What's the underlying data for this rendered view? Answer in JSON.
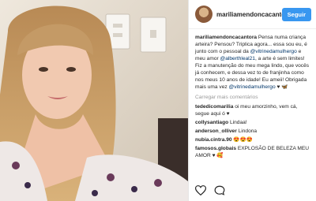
{
  "post": {
    "username": "mariliamendoncacantora",
    "follow_label": "Seguir",
    "caption": {
      "username": "mariliamendoncacantora",
      "text1": " Pensa numa criança arteira? Pensou? Triplica agora... essa sou eu, é junto com o pessoal da ",
      "mention1": "@vitrinedamulhergo",
      "text2": " e meu amor ",
      "mention2": "@alberthleal21",
      "text3": ", a arte é sem limites! Fiz a manutenção do meu mega lindo, que vocês já conhecem, e dessa vez to de franjinha como nos meus 10 anos de idade! Eu ameii! Obrigada mais uma vez ",
      "mention3": "@vitrinedamulhergo",
      "text4": " ♥ 🦋"
    },
    "load_more": "Carregar mais comentários",
    "comments": [
      {
        "user": "tededicomarilia",
        "text": " oi meu amorzinho, vem cá, segue aqui ó ♥"
      },
      {
        "user": "collysantiago",
        "text": " Lindaa!"
      },
      {
        "user": "anderson_olliver",
        "text": " Lindona"
      },
      {
        "user": "nubia.cintra.90",
        "text": " 😍😍😍"
      },
      {
        "user": "famosos.globais",
        "text": " EXPLOSÃO DE BELEZA MEU AMOR ♥ 🥰"
      }
    ],
    "icons": {
      "like": "heart-outline-icon",
      "comment": "comment-bubble-icon"
    }
  }
}
